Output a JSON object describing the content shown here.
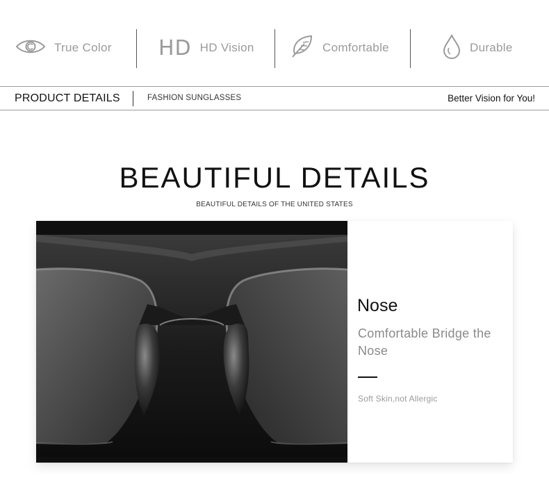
{
  "features": [
    {
      "icon": "eye-icon",
      "label": "True Color"
    },
    {
      "icon": "hd-icon",
      "icon_text": "HD",
      "label": "HD Vision"
    },
    {
      "icon": "feather-icon",
      "label": "Comfortable"
    },
    {
      "icon": "water-drop-icon",
      "label": "Durable"
    }
  ],
  "product_bar": {
    "title": "PRODUCT DETAILS",
    "subtitle": "FASHION SUNGLASSES",
    "tagline": "Better Vision for You!"
  },
  "section": {
    "heading": "BEAUTIFUL DETAILS",
    "subheading": "BEAUTIFUL DETAILS OF THE UNITED STATES"
  },
  "detail_card": {
    "title": "Nose",
    "description": "Comfortable Bridge the Nose",
    "note": "Soft Skin,not Allergic"
  },
  "colors": {
    "icon_gray": "#9a9a9a",
    "text_dark": "#111111",
    "photo_dark": "#141414"
  }
}
